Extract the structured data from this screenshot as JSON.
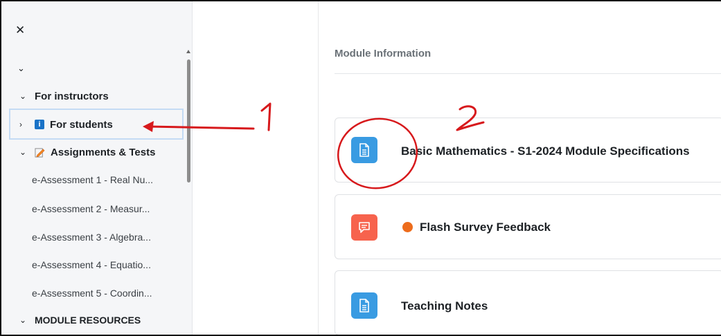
{
  "drawer": {
    "close_icon": "close-icon",
    "items": [
      {
        "label": "For instructors",
        "expanded": true
      },
      {
        "label": "For students",
        "expanded": false,
        "icon": "info-icon",
        "highlighted": true
      },
      {
        "label": "Assignments & Tests",
        "expanded": true,
        "icon": "edit-icon"
      }
    ],
    "sub_items": [
      "e-Assessment 1 - Real Nu...",
      "e-Assessment 2 - Measur...",
      "e-Assessment 3 - Algebra...",
      "e-Assessment 4 - Equatio...",
      "e-Assessment 5 - Coordin..."
    ],
    "resources_label": "MODULE RESOURCES"
  },
  "main": {
    "section_title": "Module Information",
    "cards": [
      {
        "title": "Basic Mathematics - S1-2024 Module Specifications",
        "icon": "file-icon",
        "color": "#399be2"
      },
      {
        "title": "Flash Survey Feedback",
        "icon": "feedback-icon",
        "color": "#f7634d",
        "status_dot": "#ed6c1c"
      },
      {
        "title": "Teaching Notes",
        "icon": "file-icon",
        "color": "#399be2"
      }
    ]
  },
  "annotations": {
    "label_1": "1",
    "label_2": "2",
    "color": "#d7191c"
  }
}
